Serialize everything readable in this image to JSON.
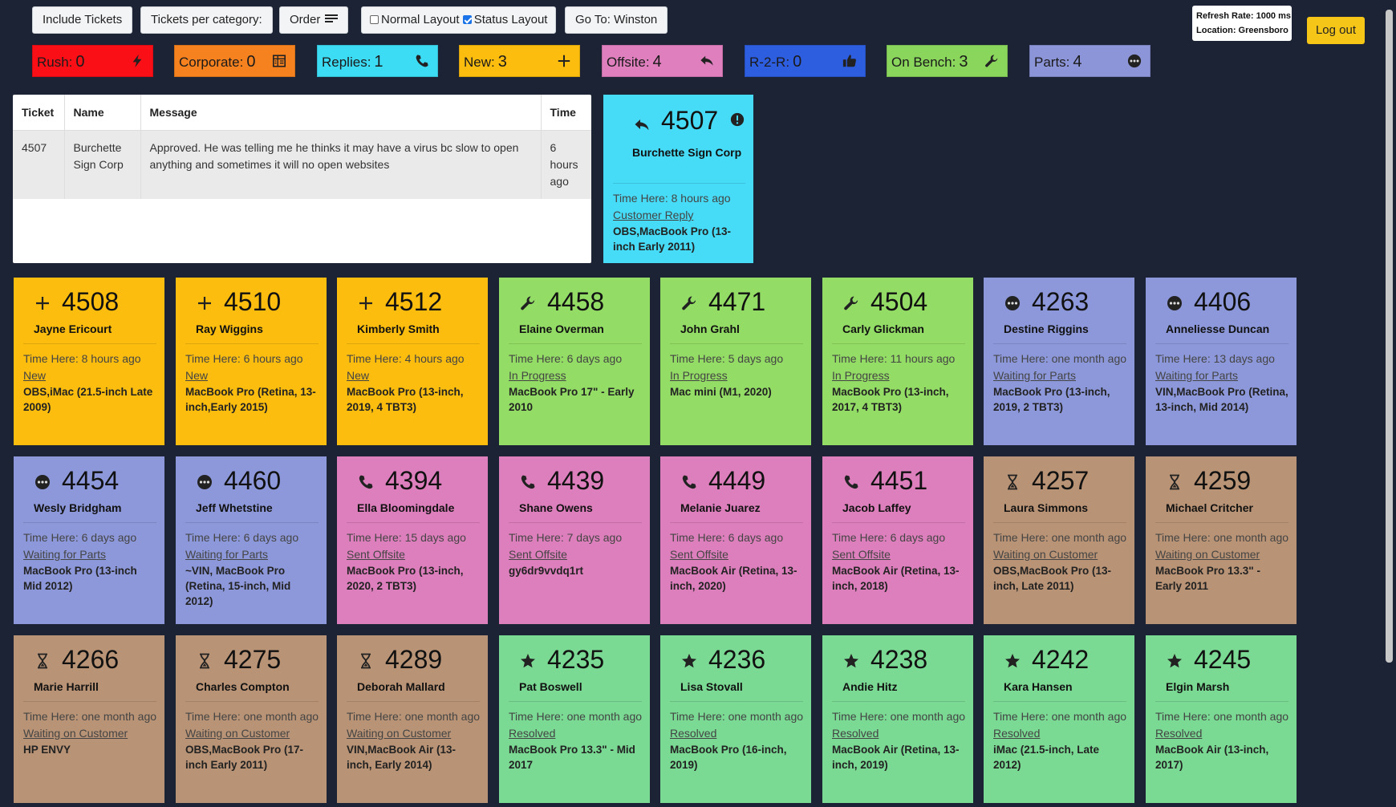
{
  "toolbar": {
    "include_tickets": "Include Tickets",
    "tickets_per_category": "Tickets per category:",
    "order": "Order",
    "normal_layout": "Normal Layout",
    "normal_layout_checked": false,
    "status_layout": "Status Layout",
    "status_layout_checked": true,
    "goto": "Go To: Winston"
  },
  "info": {
    "refresh_rate": "Refresh Rate: 1000 ms",
    "location": "Location: Greensboro"
  },
  "logout": "Log out",
  "categories": [
    {
      "label": "Rush:",
      "count": "0",
      "icon": "bolt-icon",
      "color": "#fb0f17"
    },
    {
      "label": "Corporate:",
      "count": "0",
      "icon": "building-icon",
      "color": "#f6821f"
    },
    {
      "label": "Replies:",
      "count": "1",
      "icon": "phone-icon",
      "color": "#3cdcf5"
    },
    {
      "label": "New:",
      "count": "3",
      "icon": "plus-icon",
      "color": "#fcbd0e"
    },
    {
      "label": "Offsite:",
      "count": "4",
      "icon": "reply-icon",
      "color": "#e07fbe"
    },
    {
      "label": "R-2-R:",
      "count": "0",
      "icon": "thumbs-up-icon",
      "color": "#2d5ee0"
    },
    {
      "label": "On Bench:",
      "count": "3",
      "icon": "wrench-icon",
      "color": "#8ad65c"
    },
    {
      "label": "Parts:",
      "count": "4",
      "icon": "ellipsis-circle-icon",
      "color": "#8d95d9"
    }
  ],
  "table": {
    "headers": [
      "Ticket",
      "Name",
      "Message",
      "Time"
    ],
    "rows": [
      {
        "ticket": "4507",
        "name": "Burchette Sign Corp",
        "message": "Approved. He was telling me he thinks it may have a virus bc slow to open anything and sometimes it will no open websites",
        "time": "6 hours ago"
      }
    ]
  },
  "featured": {
    "number": "4507",
    "name": "Burchette Sign Corp",
    "time_here": "Time Here: 8 hours ago",
    "status": "Customer Reply",
    "device": "OBS,MacBook Pro (13-inch Early 2011)",
    "icon": "reply-icon",
    "badge": "exclamation-circle-icon",
    "color": "#46dcf7"
  },
  "cards": [
    {
      "number": "4508",
      "name": "Jayne Ericourt",
      "time": "Time Here: 8 hours ago",
      "status": "New",
      "device": "OBS,iMac (21.5-inch Late 2009)",
      "icon": "plus-icon",
      "color": "#fcbd0e"
    },
    {
      "number": "4510",
      "name": "Ray Wiggins",
      "time": "Time Here: 6 hours ago",
      "status": "New",
      "device": "MacBook Pro (Retina, 13-inch,Early 2015)",
      "icon": "plus-icon",
      "color": "#fcbd0e"
    },
    {
      "number": "4512",
      "name": "Kimberly Smith",
      "time": "Time Here: 4 hours ago",
      "status": "New",
      "device": "MacBook Pro (13-inch, 2019, 4 TBT3)",
      "icon": "plus-icon",
      "color": "#fcbd0e"
    },
    {
      "number": "4458",
      "name": "Elaine Overman",
      "time": "Time Here: 6 days ago",
      "status": "In Progress",
      "device": "MacBook Pro 17\" - Early 2010",
      "icon": "wrench-icon",
      "color": "#93dc65"
    },
    {
      "number": "4471",
      "name": "John Grahl",
      "time": "Time Here: 5 days ago",
      "status": "In Progress",
      "device": "Mac mini (M1, 2020)",
      "icon": "wrench-icon",
      "color": "#93dc65"
    },
    {
      "number": "4504",
      "name": "Carly Glickman",
      "time": "Time Here: 11 hours ago",
      "status": "In Progress",
      "device": "MacBook Pro (13-inch, 2017, 4 TBT3)",
      "icon": "wrench-icon",
      "color": "#93dc65"
    },
    {
      "number": "4263",
      "name": "Destine Riggins",
      "time": "Time Here: one month ago",
      "status": "Waiting for Parts",
      "device": "MacBook Pro (13-inch, 2019, 2 TBT3)",
      "icon": "ellipsis-circle-icon",
      "color": "#8d98da"
    },
    {
      "number": "4406",
      "name": "Anneliesse Duncan",
      "time": "Time Here: 13 days ago",
      "status": "Waiting for Parts",
      "device": "VIN,MacBook Pro (Retina, 13-inch, Mid 2014)",
      "icon": "ellipsis-circle-icon",
      "color": "#8d98da"
    },
    {
      "number": "4454",
      "name": "Wesly Bridgham",
      "time": "Time Here: 6 days ago",
      "status": "Waiting for Parts",
      "device": "MacBook Pro (13-inch Mid 2012)",
      "icon": "ellipsis-circle-icon",
      "color": "#8d98da"
    },
    {
      "number": "4460",
      "name": "Jeff Whetstine",
      "time": "Time Here: 6 days ago",
      "status": "Waiting for Parts",
      "device": "~VIN, MacBook Pro (Retina, 15-inch, Mid 2012)",
      "icon": "ellipsis-circle-icon",
      "color": "#8d98da"
    },
    {
      "number": "4394",
      "name": "Ella Bloomingdale",
      "time": "Time Here: 15 days ago",
      "status": "Sent Offsite",
      "device": "MacBook Pro (13-inch, 2020, 2 TBT3)",
      "icon": "phone-icon",
      "color": "#de7fbd"
    },
    {
      "number": "4439",
      "name": "Shane Owens",
      "time": "Time Here: 7 days ago",
      "status": "Sent Offsite",
      "device": "gy6dr9vvdq1rt",
      "icon": "phone-icon",
      "color": "#de7fbd"
    },
    {
      "number": "4449",
      "name": "Melanie Juarez",
      "time": "Time Here: 6 days ago",
      "status": "Sent Offsite",
      "device": "MacBook Air (Retina, 13-inch, 2020)",
      "icon": "phone-icon",
      "color": "#de7fbd"
    },
    {
      "number": "4451",
      "name": "Jacob Laffey",
      "time": "Time Here: 6 days ago",
      "status": "Sent Offsite",
      "device": "MacBook Air (Retina, 13-inch, 2018)",
      "icon": "phone-icon",
      "color": "#de7fbd"
    },
    {
      "number": "4257",
      "name": "Laura Simmons",
      "time": "Time Here: one month ago",
      "status": "Waiting on Customer",
      "device": "OBS,MacBook Pro (13-inch, Late 2011)",
      "icon": "hourglass-icon",
      "color": "#b99375"
    },
    {
      "number": "4259",
      "name": "Michael Critcher",
      "time": "Time Here: one month ago",
      "status": "Waiting on Customer",
      "device": "MacBook Pro 13.3\" - Early 2011",
      "icon": "hourglass-icon",
      "color": "#b99375"
    },
    {
      "number": "4266",
      "name": "Marie Harrill",
      "time": "Time Here: one month ago",
      "status": "Waiting on Customer",
      "device": "HP ENVY",
      "icon": "hourglass-icon",
      "color": "#b99375"
    },
    {
      "number": "4275",
      "name": "Charles Compton",
      "time": "Time Here: one month ago",
      "status": "Waiting on Customer",
      "device": "OBS,MacBook Pro (17-inch Early 2011)",
      "icon": "hourglass-icon",
      "color": "#b99375"
    },
    {
      "number": "4289",
      "name": "Deborah Mallard",
      "time": "Time Here: one month ago",
      "status": "Waiting on Customer",
      "device": "VIN,MacBook Air (13-inch, Early 2014)",
      "icon": "hourglass-icon",
      "color": "#b99375"
    },
    {
      "number": "4235",
      "name": "Pat Boswell",
      "time": "Time Here: one month ago",
      "status": "Resolved",
      "device": "MacBook Pro 13.3\" - Mid 2017",
      "icon": "star-icon",
      "color": "#7ad993"
    },
    {
      "number": "4236",
      "name": "Lisa Stovall",
      "time": "Time Here: one month ago",
      "status": "Resolved",
      "device": "MacBook Pro (16-inch, 2019)",
      "icon": "star-icon",
      "color": "#7ad993"
    },
    {
      "number": "4238",
      "name": "Andie Hitz",
      "time": "Time Here: one month ago",
      "status": "Resolved",
      "device": "MacBook Air (Retina, 13-inch, 2019)",
      "icon": "star-icon",
      "color": "#7ad993"
    },
    {
      "number": "4242",
      "name": "Kara Hansen",
      "time": "Time Here: one month ago",
      "status": "Resolved",
      "device": "iMac (21.5-inch, Late 2012)",
      "icon": "star-icon",
      "color": "#7ad993"
    },
    {
      "number": "4245",
      "name": "Elgin Marsh",
      "time": "Time Here: one month ago",
      "status": "Resolved",
      "device": "MacBook Air (13-inch, 2017)",
      "icon": "star-icon",
      "color": "#7ad993"
    }
  ]
}
